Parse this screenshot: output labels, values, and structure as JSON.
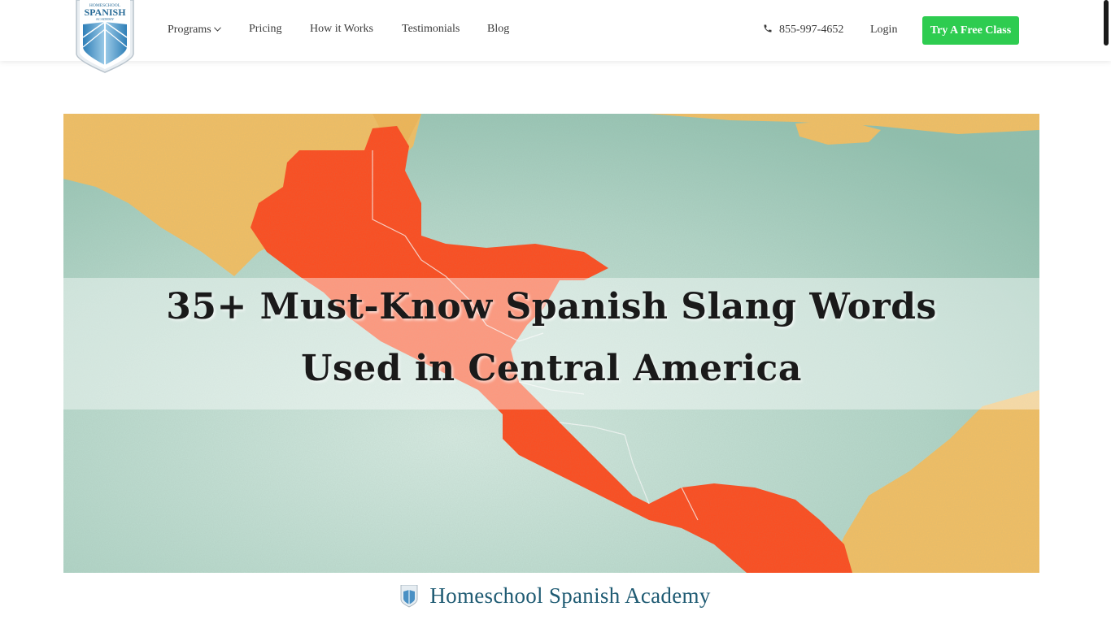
{
  "header": {
    "logo_text_top": "HOMESCHOOL",
    "logo_text_main": "SPANISH",
    "logo_text_bottom": "ACADEMY",
    "nav": [
      {
        "label": "Programs",
        "has_dropdown": true
      },
      {
        "label": "Pricing"
      },
      {
        "label": "How it Works"
      },
      {
        "label": "Testimonials"
      },
      {
        "label": "Blog"
      }
    ],
    "phone": "855-997-4652",
    "login": "Login",
    "cta": "Try A Free Class"
  },
  "hero": {
    "title_line1": "35+ Must-Know Spanish Slang Words",
    "title_line2": "Used in Central America"
  },
  "caption": {
    "brand": "Homeschool Spanish Academy"
  },
  "colors": {
    "cta_bg": "#2ecc50",
    "map_countries": "#ff4a1c",
    "map_land_mexico": "#f3bf62",
    "map_sea": "#b6d8cc",
    "brand_text": "#1f5b73"
  },
  "icons": {
    "phone": "phone-icon",
    "dropdown": "chevron-down-icon"
  }
}
